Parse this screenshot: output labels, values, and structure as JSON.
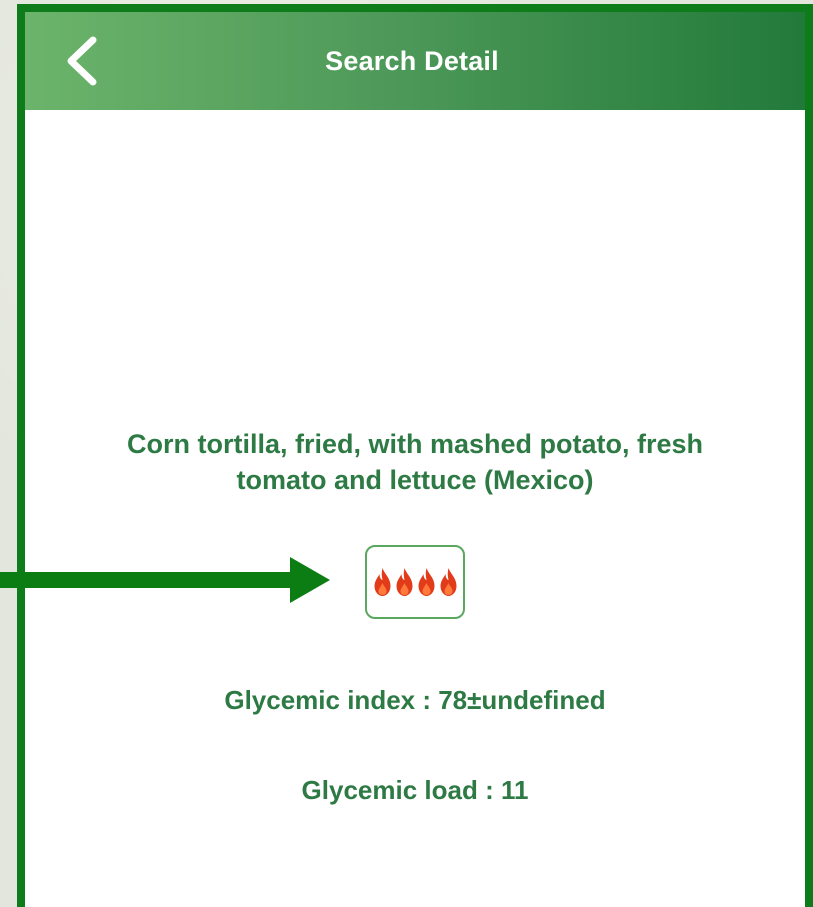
{
  "header": {
    "title": "Search Detail",
    "back_icon": "chevron-left-icon"
  },
  "food": {
    "name": "Corn tortilla, fried, with mashed potato, fresh tomato and lettuce (Mexico)",
    "gi_badge_icon": "flame-icon",
    "flame_count": 4
  },
  "glycemic_index": {
    "label": "Glycemic index",
    "value": "78±undefined",
    "text": "Glycemic index : 78±undefined"
  },
  "glycemic_load": {
    "label": "Glycemic load",
    "value": "11",
    "text": "Glycemic load : 11"
  },
  "annotation": {
    "arrow_icon": "arrow-right-icon"
  },
  "colors": {
    "frame": "#0e7c1a",
    "header_start": "#6cb46b",
    "header_end": "#227a3a",
    "text_green": "#2e7a45",
    "flame_red": "#e23b1a",
    "arrow_green": "#0b7d12"
  }
}
